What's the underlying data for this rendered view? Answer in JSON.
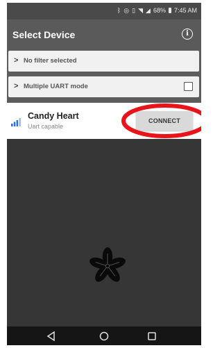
{
  "status_bar": {
    "battery": "68%",
    "time": "7:45 AM",
    "icons": [
      "bluetooth-icon",
      "alarm-icon",
      "vibrate-icon",
      "wifi-icon",
      "signal-icon",
      "battery-icon"
    ]
  },
  "app_bar": {
    "title": "Select Device",
    "info_icon": "info-icon"
  },
  "settings": {
    "filter_label": "No filter selected",
    "uart_label": "Multiple UART mode",
    "uart_checked": false
  },
  "devices": [
    {
      "name": "Candy Heart",
      "subtitle": "Uart capable",
      "connect_label": "CONNECT",
      "signal_icon": "signal-strength-icon"
    }
  ],
  "annotation": {
    "color": "#e8141a"
  },
  "colors": {
    "background": "#363636",
    "app_bar": "#5a5a5a",
    "signal_blue": "#2d6fd6"
  },
  "nav_bar": {
    "icons": [
      "back-icon",
      "home-icon",
      "recents-icon"
    ]
  }
}
